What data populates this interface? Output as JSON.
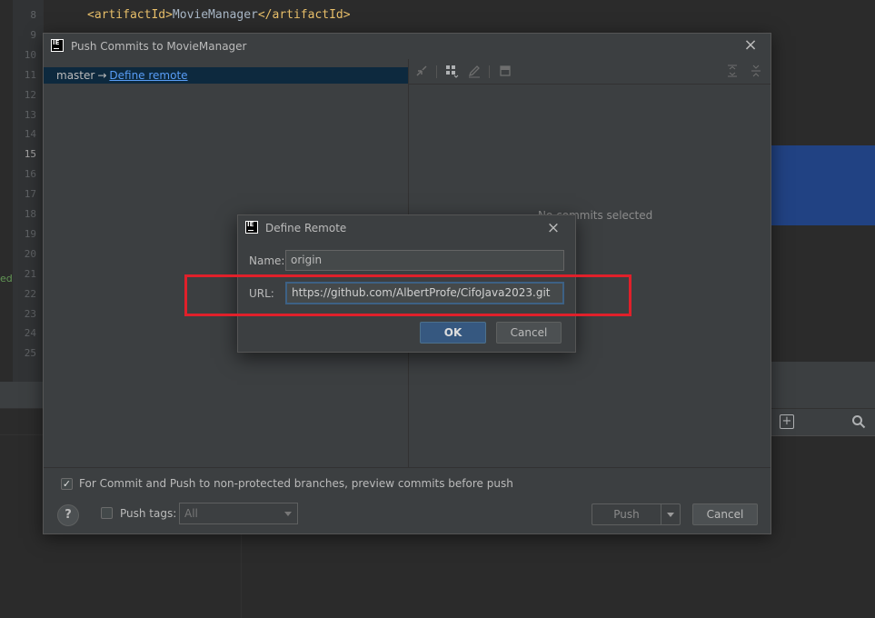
{
  "editor": {
    "lines": [
      {
        "num": "8",
        "code_open": "<artifactId>",
        "code_text": "MovieManager",
        "code_close": "</artifactId>"
      },
      {
        "num": "9"
      },
      {
        "num": "10"
      },
      {
        "num": "11"
      },
      {
        "num": "12"
      },
      {
        "num": "13"
      },
      {
        "num": "14"
      },
      {
        "num": "15"
      },
      {
        "num": "16"
      },
      {
        "num": "17"
      },
      {
        "num": "18"
      },
      {
        "num": "19"
      },
      {
        "num": "20"
      },
      {
        "num": "21"
      },
      {
        "num": "22"
      },
      {
        "num": "23"
      },
      {
        "num": "24"
      },
      {
        "num": "25"
      }
    ],
    "gutter_marker": "ed"
  },
  "push_dialog": {
    "title": "Push Commits to MovieManager",
    "branch": "master",
    "arrow": "→",
    "define_remote_link": "Define remote",
    "no_commits_text": "No commits selected",
    "preview_label": "For Commit and Push to non-protected branches, preview commits before push",
    "preview_checked": true,
    "help_label": "?",
    "push_tags_label": "Push tags:",
    "push_tags_checked": false,
    "push_tags_value": "All",
    "push_button": "Push",
    "cancel_button": "Cancel"
  },
  "remote_dialog": {
    "title": "Define Remote",
    "name_label": "Name:",
    "name_value": "origin",
    "url_label": "URL:",
    "url_value": "https://github.com/AlbertProfe/CifoJava2023.git",
    "ok_button": "OK",
    "cancel_button": "Cancel"
  },
  "logo_text": "IE",
  "colors": {
    "highlight": "#e0202a",
    "ok_button": "#365880",
    "link": "#589df6",
    "dialog_bg": "#3c3f41"
  }
}
